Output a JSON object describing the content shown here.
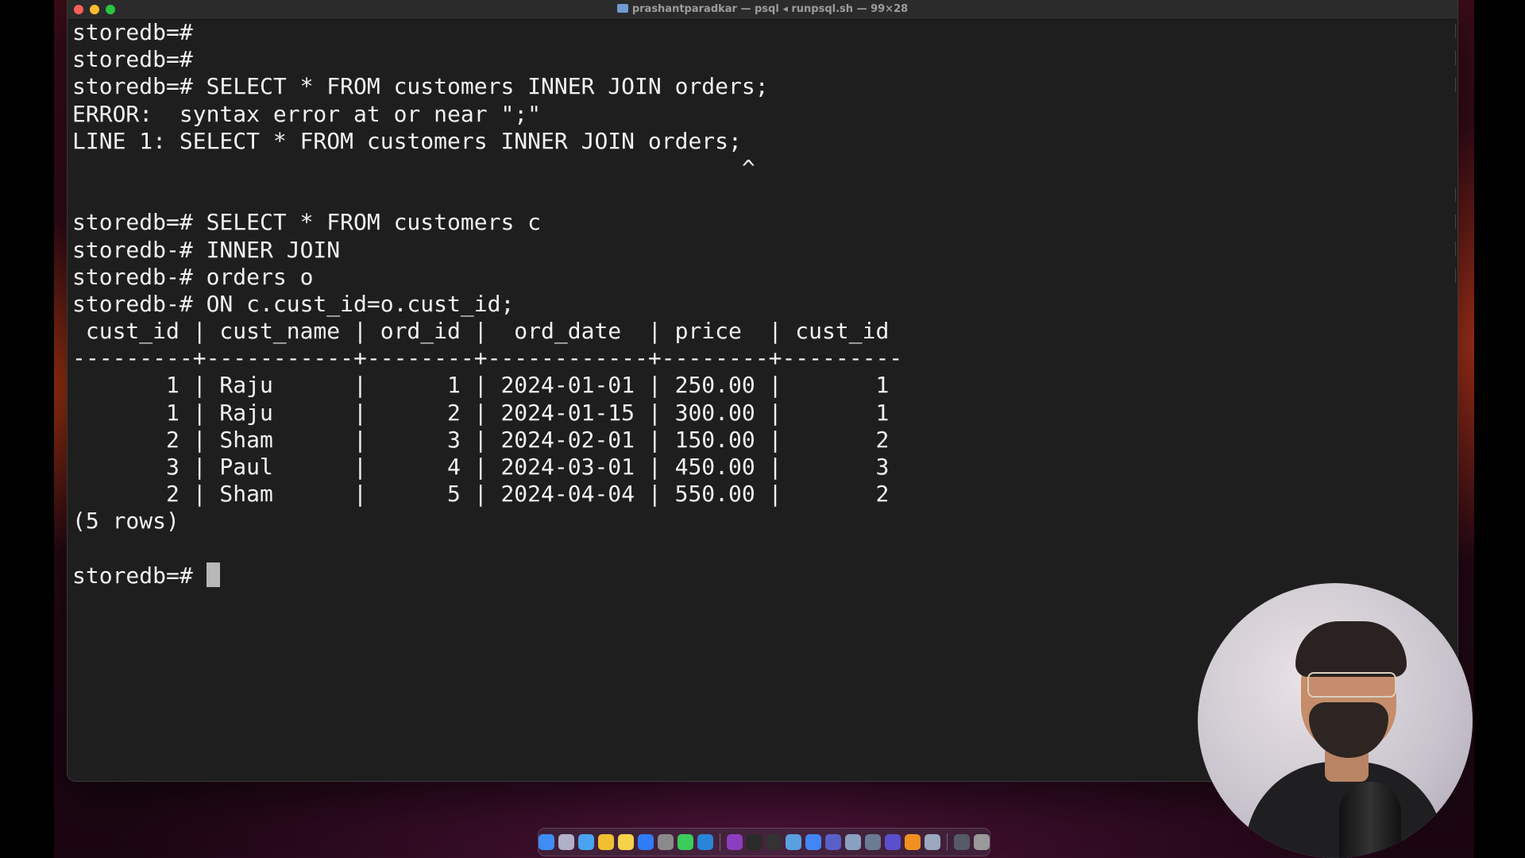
{
  "window": {
    "title": "prashantparadkar — psql ◂ runpsql.sh — 99×28"
  },
  "terminal": {
    "lines": [
      "storedb=#",
      "storedb=#",
      "storedb=# SELECT * FROM customers INNER JOIN orders;",
      "ERROR:  syntax error at or near \";\"",
      "LINE 1: SELECT * FROM customers INNER JOIN orders;",
      "                                                  ^",
      "",
      "storedb=# SELECT * FROM customers c",
      "storedb-# INNER JOIN",
      "storedb-# orders o",
      "storedb-# ON c.cust_id=o.cust_id;",
      " cust_id | cust_name | ord_id |  ord_date  | price  | cust_id",
      "---------+-----------+--------+------------+--------+---------",
      "       1 | Raju      |      1 | 2024-01-01 | 250.00 |       1",
      "       1 | Raju      |      2 | 2024-01-15 | 300.00 |       1",
      "       2 | Sham      |      3 | 2024-02-01 | 150.00 |       2",
      "       3 | Paul      |      4 | 2024-03-01 | 450.00 |       3",
      "       2 | Sham      |      5 | 2024-04-04 | 550.00 |       2",
      "(5 rows)",
      ""
    ],
    "prompt": "storedb=# "
  },
  "colors": {
    "terminal_bg": "#1e1e1e",
    "terminal_fg": "#f2f2f2",
    "close": "#fe5f57",
    "minimize": "#febc2e",
    "maximize": "#28c840"
  },
  "dock": {
    "icons": [
      {
        "name": "finder-icon",
        "color": "#3d8df5"
      },
      {
        "name": "launchpad-icon",
        "color": "#b0b0c8"
      },
      {
        "name": "safari-icon",
        "color": "#4aa3f0"
      },
      {
        "name": "chrome-icon",
        "color": "#f0c030"
      },
      {
        "name": "notes-icon",
        "color": "#f5d24a"
      },
      {
        "name": "app-store-icon",
        "color": "#2f7cf6"
      },
      {
        "name": "settings-icon",
        "color": "#8a8a8a"
      },
      {
        "name": "messages-icon",
        "color": "#3ccc5c"
      },
      {
        "name": "vscode-icon",
        "color": "#2a84d8"
      },
      {
        "name": "sep",
        "color": ""
      },
      {
        "name": "onenote-icon",
        "color": "#8b3fbf"
      },
      {
        "name": "terminal-icon",
        "color": "#2a2a2a"
      },
      {
        "name": "terminal-2-icon",
        "color": "#333333"
      },
      {
        "name": "preview-icon",
        "color": "#5a9fe0"
      },
      {
        "name": "google-icon",
        "color": "#4285f4"
      },
      {
        "name": "teams-icon",
        "color": "#5a5fc7"
      },
      {
        "name": "elephant-icon",
        "color": "#8aa0c0"
      },
      {
        "name": "screen-icon",
        "color": "#6a7a90"
      },
      {
        "name": "star-icon",
        "color": "#5a4fcf"
      },
      {
        "name": "sublime-icon",
        "color": "#f09020"
      },
      {
        "name": "pgadmin-icon",
        "color": "#9aa8c0"
      },
      {
        "name": "sep",
        "color": ""
      },
      {
        "name": "keyboard-icon",
        "color": "#555b66"
      },
      {
        "name": "trash-icon",
        "color": "#9a9a9a"
      }
    ]
  }
}
